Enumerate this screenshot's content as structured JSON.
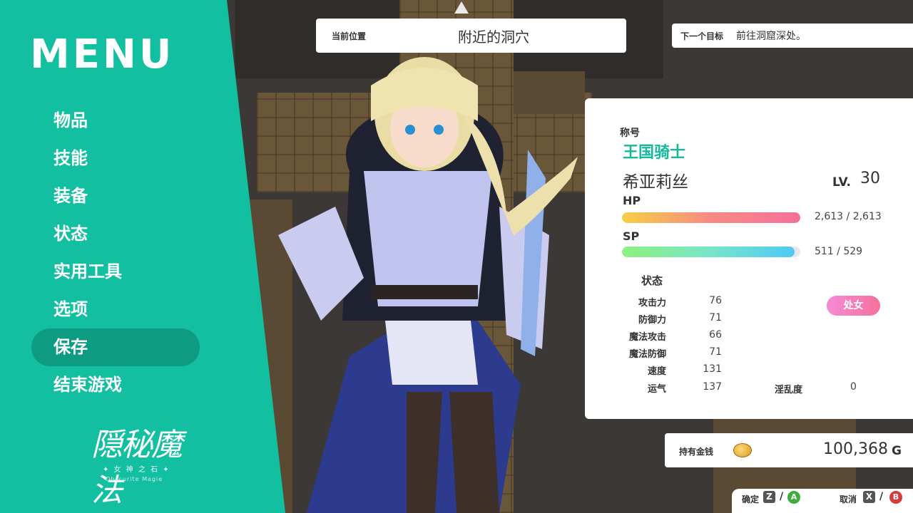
{
  "menu": {
    "title": "MENU",
    "items": [
      {
        "label": "物品"
      },
      {
        "label": "技能"
      },
      {
        "label": "装备"
      },
      {
        "label": "状态"
      },
      {
        "label": "实用工具"
      },
      {
        "label": "选项"
      },
      {
        "label": "保存",
        "selected": true
      },
      {
        "label": "结束游戏"
      }
    ]
  },
  "logo": {
    "title": "隠秘魔法",
    "subtitle": "✦ 女 神 之 石 ✦",
    "subtitle2": "Obscurite Magie"
  },
  "location": {
    "label": "当前位置",
    "value": "附近的洞穴"
  },
  "goal": {
    "label": "下一个目标",
    "value": "前往洞窟深处。"
  },
  "status": {
    "title_label": "称号",
    "title_value": "王国骑士",
    "name": "希亚莉丝",
    "lv_label": "LV.",
    "lv": "30",
    "hp_label": "HP",
    "hp_text": "2,613 / 2,613",
    "hp_ratio": 1.0,
    "sp_label": "SP",
    "sp_text": "511 / 529",
    "sp_ratio": 0.966,
    "attr_header": "状态",
    "attributes": [
      {
        "name": "攻击力",
        "value": "76"
      },
      {
        "name": "防御力",
        "value": "71"
      },
      {
        "name": "魔法攻击",
        "value": "66"
      },
      {
        "name": "魔法防御",
        "value": "71"
      },
      {
        "name": "速度",
        "value": "131"
      },
      {
        "name": "运气",
        "value": "137"
      }
    ],
    "badge": "处女",
    "lewd_label": "淫乱度",
    "lewd_value": "0"
  },
  "money": {
    "label": "持有金钱",
    "value": "100,368",
    "unit": "G",
    "icon": "coin-icon"
  },
  "keys": {
    "confirm_label": "确定",
    "confirm_key": "Z",
    "confirm_pad": "A",
    "cancel_label": "取消",
    "cancel_key": "X",
    "cancel_pad": "B"
  },
  "colors": {
    "accent": "#12bfa0",
    "selected": "#0d9c82",
    "title": "#16b99c"
  }
}
